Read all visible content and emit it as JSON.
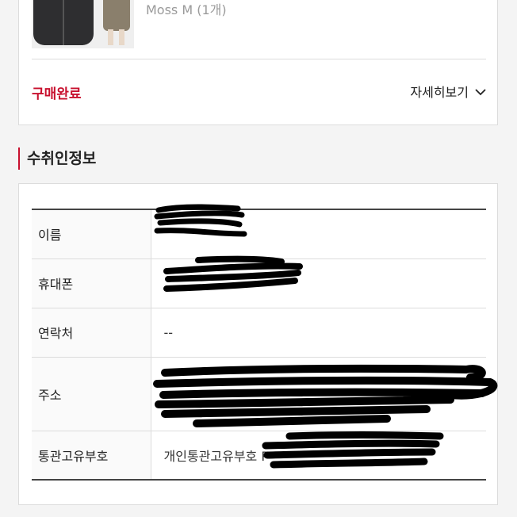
{
  "order": {
    "option_text": "Moss M (1개)",
    "status": "구매완료",
    "detail_label": "자세히보기"
  },
  "recipient": {
    "section_title": "수취인정보",
    "rows": [
      {
        "label": "이름",
        "value": ""
      },
      {
        "label": "휴대폰",
        "value": ""
      },
      {
        "label": "연락처",
        "value": "--"
      },
      {
        "label": "주소",
        "value": ""
      },
      {
        "label": "통관고유부호",
        "value": "개인통관고유부호 P"
      }
    ]
  },
  "colors": {
    "accent": "#c8102e",
    "background": "#f4f4f4",
    "redaction": "#000000"
  },
  "icons": [
    "chevron-down-icon"
  ]
}
